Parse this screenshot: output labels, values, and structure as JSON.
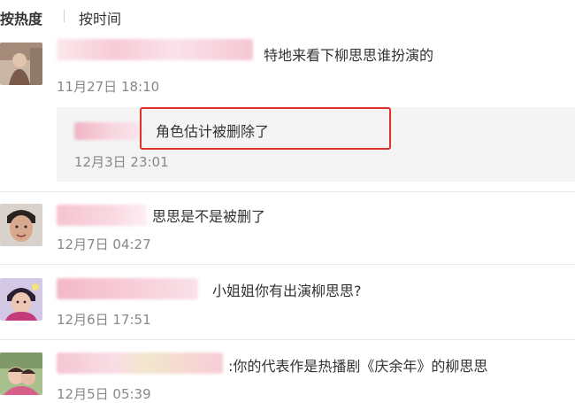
{
  "sort": {
    "hot_label": "按热度",
    "time_label": "按时间"
  },
  "comments": [
    {
      "text": "特地来看下柳思思谁扮演的",
      "time": "11月27日 18:10",
      "avatar": "avatar-person-icon"
    },
    {
      "text": "思思是不是被删了",
      "time": "12月7日 04:27",
      "avatar": "avatar-person-icon"
    },
    {
      "text": "小姐姐你有出演柳思思?",
      "time": "12月6日 17:51",
      "avatar": "avatar-person-icon"
    },
    {
      "text": ":你的代表作是热播剧《庆余年》的柳思思",
      "time": "12月5日 05:39",
      "avatar": "avatar-person-icon"
    }
  ],
  "reply": {
    "text": "角色估计被删除了",
    "time": "12月3日 23:01"
  },
  "colors": {
    "highlight": "#e0302a",
    "reply_bg": "#f4f4f4",
    "blur_pink": "#f6c9d6",
    "timestamp": "#888888"
  }
}
